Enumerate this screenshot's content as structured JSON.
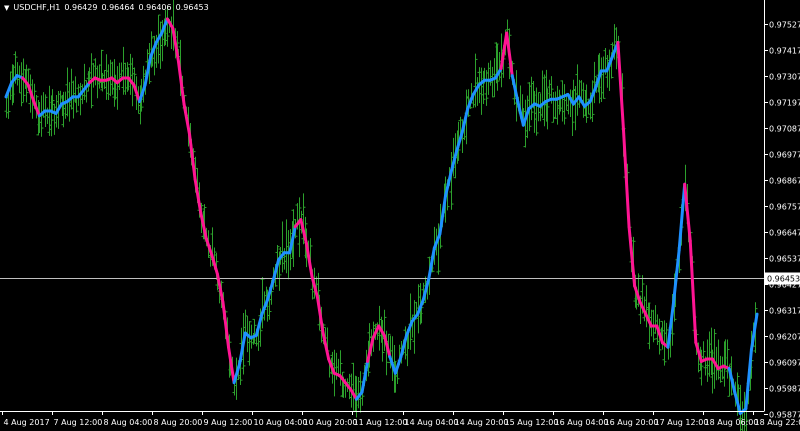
{
  "header": {
    "symbol": "USDCHF,H1",
    "open": "0.96429",
    "high": "0.96464",
    "low": "0.96406",
    "close": "0.96453"
  },
  "colors": {
    "background": "#000000",
    "bars": "#2ca02c",
    "ma_up": "#1e90ff",
    "ma_down": "#ff1493",
    "axis": "#ffffff",
    "bid_line": "#bfbfbf"
  },
  "current_price_label": "0.96453",
  "chart_data": {
    "type": "line",
    "title": "USDCHF,H1",
    "ylim": [
      0.9589,
      0.9763
    ],
    "y_ticks": [
      "0.97527",
      "0.97417",
      "0.97307",
      "0.97197",
      "0.97087",
      "0.96977",
      "0.96867",
      "0.96757",
      "0.96647",
      "0.96537",
      "0.96427",
      "0.96317",
      "0.96207",
      "0.96097",
      "0.95987",
      "0.95877"
    ],
    "x_ticks": [
      "4 Aug 2017",
      "7 Aug 12:00",
      "8 Aug 04:00",
      "8 Aug 20:00",
      "9 Aug 12:00",
      "10 Aug 04:00",
      "10 Aug 20:00",
      "11 Aug 12:00",
      "14 Aug 04:00",
      "14 Aug 20:00",
      "15 Aug 12:00",
      "16 Aug 04:00",
      "16 Aug 20:00",
      "17 Aug 12:00",
      "18 Aug 06:00",
      "18 Aug 22:00"
    ],
    "current_price": 0.96453,
    "series": [
      {
        "values": [
          0.9722,
          0.9728,
          0.9731,
          0.973,
          0.9727,
          0.972,
          0.9714,
          0.9716,
          0.9716,
          0.9715,
          0.9719,
          0.972,
          0.9722,
          0.9722,
          0.9725,
          0.9728,
          0.973,
          0.9729,
          0.9729,
          0.973,
          0.9728,
          0.973,
          0.973,
          0.9727,
          0.972,
          0.9727,
          0.9739,
          0.9745,
          0.9749,
          0.9755,
          0.9751,
          0.9737,
          0.9719,
          0.9706,
          0.9687,
          0.9673,
          0.9662,
          0.9655,
          0.9647,
          0.9635,
          0.9616,
          0.9601,
          0.9609,
          0.9622,
          0.962,
          0.9621,
          0.963,
          0.9636,
          0.9644,
          0.9653,
          0.9656,
          0.9656,
          0.9667,
          0.967,
          0.966,
          0.9646,
          0.9637,
          0.9622,
          0.9611,
          0.9605,
          0.9604,
          0.9601,
          0.9598,
          0.9594,
          0.9597,
          0.961,
          0.962,
          0.9625,
          0.9621,
          0.9612,
          0.9605,
          0.9612,
          0.9621,
          0.9627,
          0.963,
          0.9636,
          0.9645,
          0.9658,
          0.9664,
          0.968,
          0.969,
          0.9699,
          0.9707,
          0.9717,
          0.9723,
          0.9727,
          0.9729,
          0.9729,
          0.973,
          0.9734,
          0.9749,
          0.9731,
          0.972,
          0.971,
          0.9717,
          0.9719,
          0.9718,
          0.972,
          0.9721,
          0.9721,
          0.9722,
          0.9723,
          0.9719,
          0.9722,
          0.9718,
          0.972,
          0.9726,
          0.9733,
          0.9733,
          0.9739,
          0.9745,
          0.9708,
          0.9667,
          0.9642,
          0.9635,
          0.963,
          0.9625,
          0.9625,
          0.9618,
          0.9616,
          0.9635,
          0.9657,
          0.9685,
          0.9661,
          0.9618,
          0.961,
          0.9611,
          0.9611,
          0.9607,
          0.9608,
          0.9607,
          0.9597,
          0.9588,
          0.959,
          0.9615,
          0.963
        ],
        "trend": [
          "up",
          "up",
          "up",
          "down",
          "down",
          "down",
          "up",
          "up",
          "up",
          "up",
          "up",
          "up",
          "up",
          "up",
          "up",
          "down",
          "down",
          "down",
          "down",
          "down",
          "down",
          "down",
          "down",
          "down",
          "up",
          "up",
          "up",
          "up",
          "up",
          "down",
          "down",
          "down",
          "down",
          "down",
          "down",
          "down",
          "down",
          "down",
          "down",
          "down",
          "down",
          "up",
          "up",
          "up",
          "up",
          "up",
          "up",
          "up",
          "up",
          "up",
          "up",
          "up",
          "down",
          "down",
          "down",
          "down",
          "down",
          "down",
          "down",
          "down",
          "down",
          "down",
          "down",
          "up",
          "up",
          "down",
          "down",
          "down",
          "down",
          "up",
          "up",
          "up",
          "up",
          "up",
          "up",
          "up",
          "up",
          "up",
          "up",
          "up",
          "up",
          "up",
          "up",
          "up",
          "up",
          "up",
          "up",
          "up",
          "up",
          "down",
          "down",
          "up",
          "up",
          "up",
          "up",
          "up",
          "up",
          "up",
          "up",
          "up",
          "up",
          "up",
          "up",
          "up",
          "up",
          "up",
          "up",
          "up",
          "up",
          "up",
          "down",
          "down",
          "down",
          "down",
          "down",
          "down",
          "down",
          "down",
          "down",
          "up",
          "up",
          "up",
          "down",
          "down",
          "down",
          "down",
          "down",
          "down",
          "down",
          "down",
          "up",
          "up",
          "up",
          "up",
          "up"
        ]
      }
    ]
  }
}
